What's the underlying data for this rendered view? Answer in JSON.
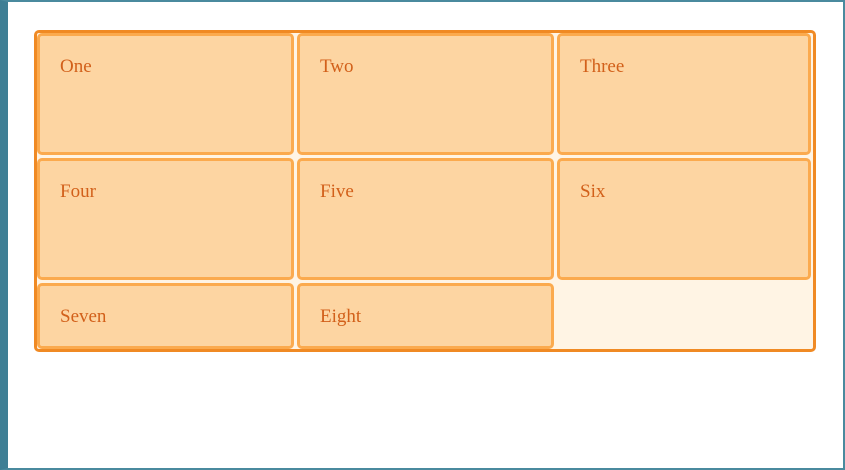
{
  "grid": {
    "items": [
      {
        "label": "One"
      },
      {
        "label": "Two"
      },
      {
        "label": "Three"
      },
      {
        "label": "Four"
      },
      {
        "label": "Five"
      },
      {
        "label": "Six"
      },
      {
        "label": "Seven"
      },
      {
        "label": "Eight"
      }
    ]
  },
  "colors": {
    "container_border": "#f08a24",
    "container_background": "#fff4e4",
    "item_background": "#fdd5a2",
    "item_border": "#fbaa4e",
    "item_text": "#d2601a",
    "frame_border": "#3f7f95"
  }
}
